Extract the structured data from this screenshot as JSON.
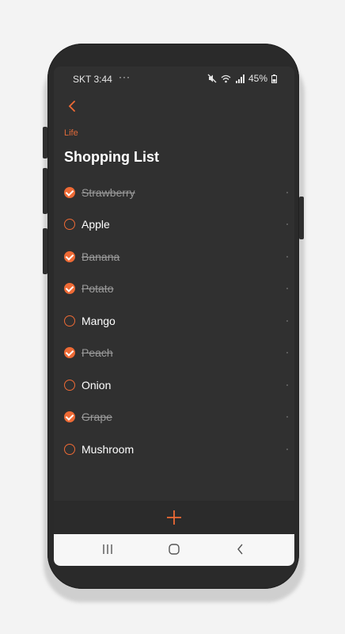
{
  "status_bar": {
    "carrier_time": "SKT 3:44",
    "more": "···",
    "battery": "45%"
  },
  "header": {
    "category": "Life",
    "title": "Shopping List"
  },
  "items": [
    {
      "label": "Strawberry",
      "checked": true
    },
    {
      "label": "Apple",
      "checked": false
    },
    {
      "label": "Banana",
      "checked": true
    },
    {
      "label": "Potato",
      "checked": true
    },
    {
      "label": "Mango",
      "checked": false
    },
    {
      "label": "Peach",
      "checked": true
    },
    {
      "label": "Onion",
      "checked": false
    },
    {
      "label": "Grape",
      "checked": true
    },
    {
      "label": "Mushroom",
      "checked": false
    }
  ],
  "colors": {
    "accent": "#ee6a35",
    "background": "#303030",
    "text": "#ffffff",
    "done_text": "#9a9a9a"
  },
  "icons": {
    "back": "chevron-left-icon",
    "add": "plus-icon",
    "recents": "recents-icon",
    "home": "home-icon",
    "nav_back": "back-icon"
  }
}
